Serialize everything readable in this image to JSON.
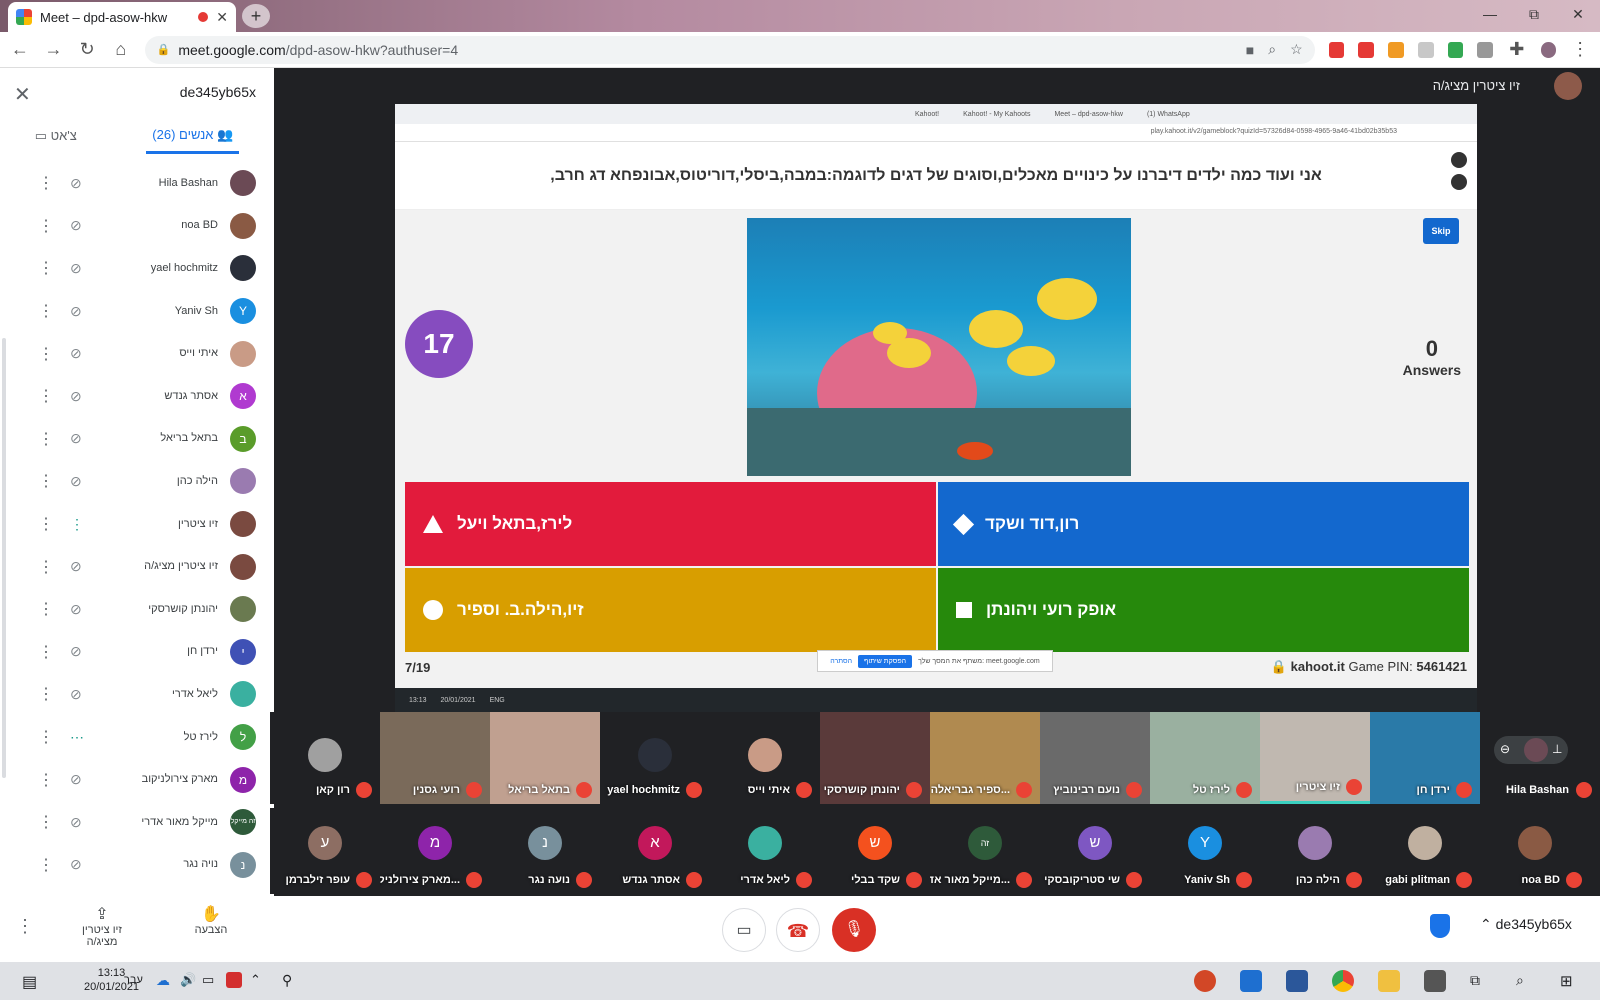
{
  "browser": {
    "tab_title": "Meet – dpd-asow-hkw",
    "new_tab": "+",
    "url_host": "meet.google.com",
    "url_path": "/dpd-asow-hkw?authuser=4",
    "win_min": "—",
    "win_max": "⧉",
    "win_close": "✕"
  },
  "sidebar": {
    "meeting_code": "de345yb65x",
    "tab_people": "אנשים (26)",
    "tab_chat": "צ'אט",
    "participants": [
      {
        "name": "Hila Bashan",
        "initial": "",
        "color": "#6b4a55"
      },
      {
        "name": "noa BD",
        "initial": "",
        "color": "#8a5a44"
      },
      {
        "name": "yael hochmitz",
        "initial": "",
        "color": "#2a2f3a"
      },
      {
        "name": "Yaniv Sh",
        "initial": "Y",
        "color": "#1a8fe0"
      },
      {
        "name": "איתי וייס",
        "initial": "",
        "color": "#c99b86"
      },
      {
        "name": "אסתר גנדש",
        "initial": "א",
        "color": "#b03ad0"
      },
      {
        "name": "בתאל בריאל",
        "initial": "ב",
        "color": "#5a9c2a"
      },
      {
        "name": "הילה כהן",
        "initial": "",
        "color": "#9a7bb0"
      },
      {
        "name": "זיו ציטרין",
        "initial": "",
        "color": "#7a4a40"
      },
      {
        "name": "זיו ציטרין מציג/ה",
        "initial": "",
        "color": "#7a4a40"
      },
      {
        "name": "יהונתן קושרסקי",
        "initial": "",
        "color": "#6a7a50"
      },
      {
        "name": "ירדן חן",
        "initial": "י",
        "color": "#3f51b5"
      },
      {
        "name": "ליאל אדרי",
        "initial": "",
        "color": "#3ab0a0"
      },
      {
        "name": "לירז טל",
        "initial": "ל",
        "color": "#43a047"
      },
      {
        "name": "מארק צירולניקוב",
        "initial": "מ",
        "color": "#8e24aa"
      },
      {
        "name": "מייקל מאור אדרי",
        "initial": "זה מייקל",
        "color": "#2e5a3a"
      },
      {
        "name": "נויה נגר",
        "initial": "נ",
        "color": "#78909c"
      }
    ]
  },
  "presenter": {
    "name": "זיו ציטרין מציג/ה"
  },
  "shared_screen": {
    "inner_tabs": [
      "Kahoot!",
      "Kahoot! - My Kahoots",
      "Meet – dpd-asow-hkw",
      "(1) WhatsApp"
    ],
    "inner_url": "play.kahoot.it/v2/gameblock?quizId=57326d84-0598-4965-9a46-41bd02b35b53",
    "question": "אני ועוד כמה ילדים דיברנו על כינויים מאכלים,וסוגים של דגים לדוגמה:במבה,ביסלי,דוריטוס,אבונפחא דג חרב,",
    "timer": "17",
    "answers_count": "0",
    "answers_label": "Answers",
    "skip": "Skip",
    "answer_red": "לירז,בתאל ויעל",
    "answer_blue": "רון,דוד ושקד",
    "answer_yellow": "זיו,הילה.ב. וספיר",
    "answer_green": "אופק רועי ויהונתן",
    "progress": "7/19",
    "brand": "kahoot.it",
    "pin_label": "Game PIN:",
    "pin": "5461421",
    "share_text": "משתף את המסך שלך: meet.google.com",
    "share_stop": "הפסקת שיתוף",
    "share_hide": "הסתרה",
    "inner_time": "13:13",
    "inner_date": "20/01/2021",
    "inner_lang": "ENG"
  },
  "video_row1": [
    {
      "name": "רון קאן",
      "color": "#a0a0a0"
    },
    {
      "name": "רועי גסנין",
      "color": "#7a6a5a"
    },
    {
      "name": "בתאל בריאל",
      "color": "#c0a090"
    },
    {
      "name": "yael hochmitz",
      "color": "#2a2f3a"
    },
    {
      "name": "איתי וייס",
      "color": "#c99b86"
    },
    {
      "name": "יהונתן קושרסקי",
      "color": "#5a3a3a"
    },
    {
      "name": "ספיר גבריאלה...",
      "color": "#b08a50"
    },
    {
      "name": "נועם רבינוביץ",
      "color": "#6a6a6a"
    },
    {
      "name": "לירז טל",
      "color": "#9ab0a0"
    },
    {
      "name": "זיו ציטרין",
      "color": "#c0b8b0"
    },
    {
      "name": "ירדן חן",
      "color": "#2a7aa8"
    }
  ],
  "pinned_tile": {
    "name": "Hila Bashan"
  },
  "video_row2": [
    {
      "name": "עופר זילברמן",
      "initial": "ע",
      "color": "#8d6e63"
    },
    {
      "name": "מארק צירולניק...",
      "initial": "מ",
      "color": "#8e24aa"
    },
    {
      "name": "נועה נגר",
      "initial": "נ",
      "color": "#78909c"
    },
    {
      "name": "אסתר גנדש",
      "initial": "א",
      "color": "#c2185b"
    },
    {
      "name": "ליאל אדרי",
      "initial": "",
      "color": "#3ab0a0"
    },
    {
      "name": "שקד בבלי",
      "initial": "ש",
      "color": "#f4511e"
    },
    {
      "name": "מייקל מאור אד...",
      "initial": "זה",
      "color": "#2e5a3a"
    },
    {
      "name": "שי סטריקובסקי",
      "initial": "ש",
      "color": "#7e57c2"
    },
    {
      "name": "Yaniv Sh",
      "initial": "Y",
      "color": "#1a8fe0"
    },
    {
      "name": "הילה כהן",
      "initial": "",
      "color": "#9a7bb0"
    },
    {
      "name": "gabi plitman",
      "initial": "",
      "color": "#c0b0a0"
    },
    {
      "name": "noa BD",
      "initial": "",
      "color": "#8a5a44"
    }
  ],
  "controls": {
    "present_label": "זיו ציטרין מציג/ה",
    "raise_label": "הצבעה",
    "meeting_code": "de345yb65x"
  },
  "taskbar": {
    "time": "13:13",
    "date": "20/01/2021",
    "lang": "עבר"
  }
}
